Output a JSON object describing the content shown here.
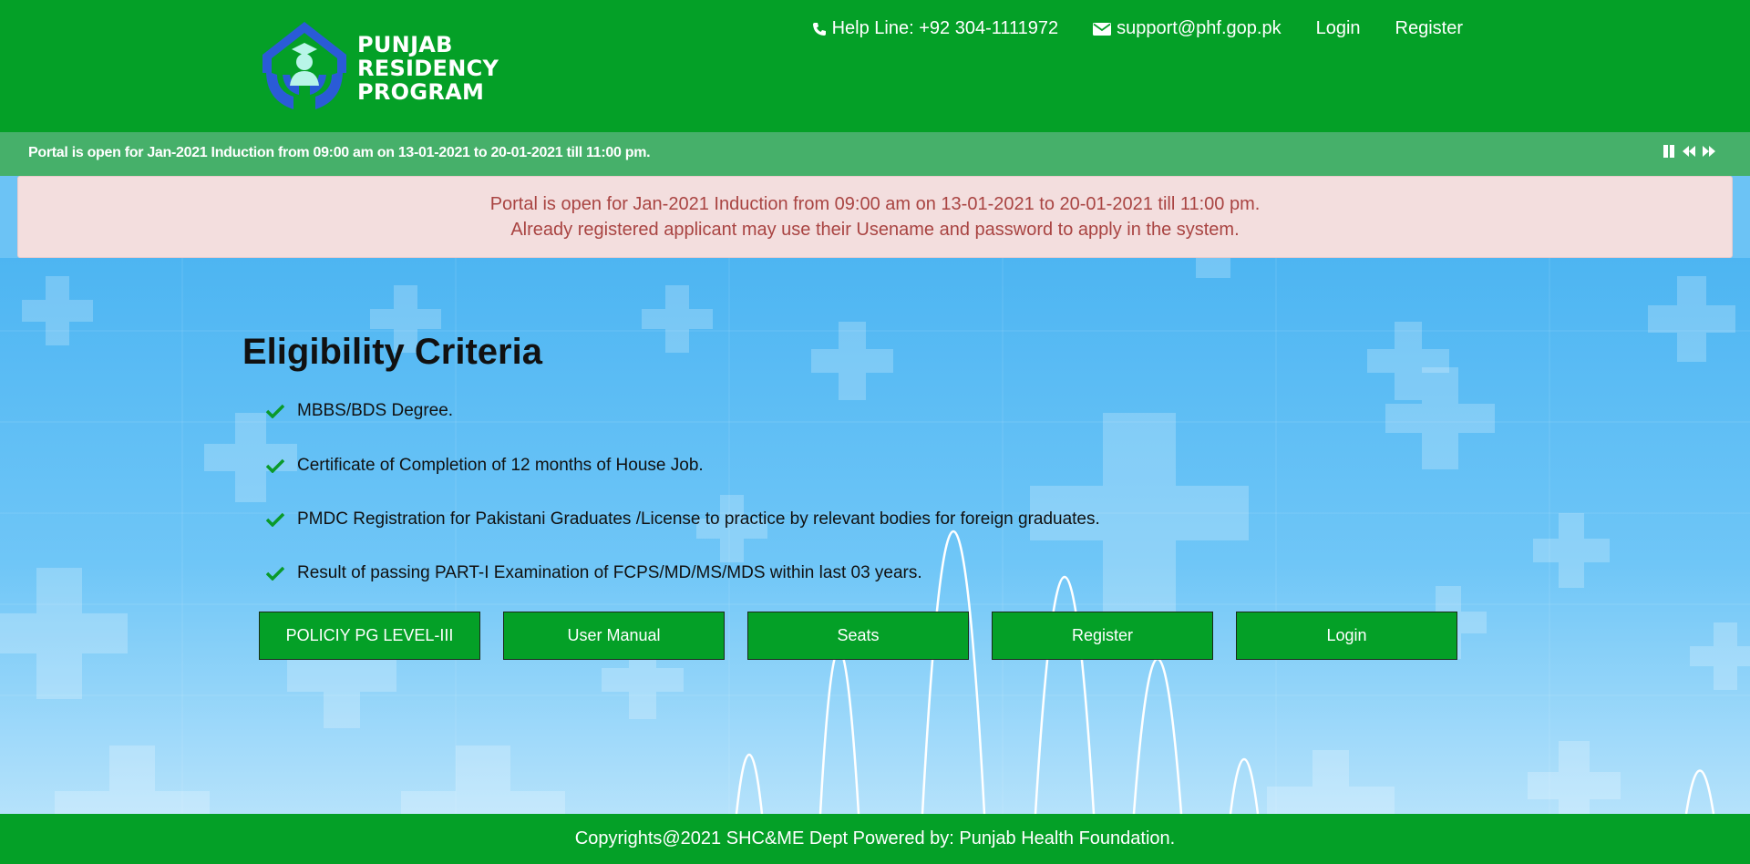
{
  "header": {
    "logo_lines": [
      "PUNJAB",
      "RESIDENCY",
      "PROGRAM"
    ],
    "helpline": "Help Line: +92 304-1111972",
    "email": "support@phf.gop.pk",
    "login": "Login",
    "register": "Register",
    "bg_color": "#04a027"
  },
  "marquee": {
    "text": "Portal is open for Jan-2021 Induction from 09:00 am on 13-01-2021 to 20-01-2021 till 11:00 pm.",
    "controls": [
      "pause-icon",
      "rewind-icon",
      "fast-forward-icon"
    ]
  },
  "alert": {
    "line1": "Portal is open for Jan-2021 Induction from 09:00 am on 13-01-2021 to 20-01-2021 till 11:00 pm.",
    "line2": "Already registered applicant may use their Usename and password to apply in the system.",
    "text_color": "#a94442",
    "bg_color": "#f3dede"
  },
  "main": {
    "title": "Eligibility Criteria",
    "criteria": [
      "MBBS/BDS Degree.",
      "Certificate of Completion of 12 months of House Job.",
      "PMDC Registration for Pakistani Graduates /License to practice by relevant bodies for foreign graduates.",
      "Result of passing PART-I Examination of FCPS/MD/MS/MDS within last 03 years."
    ],
    "buttons": [
      "POLICIY PG LEVEL-III",
      "User Manual",
      "Seats",
      "Register",
      "Login"
    ]
  },
  "footer": {
    "text": "Copyrights@2021 SHC&ME Dept Powered by: Punjab Health Foundation."
  }
}
